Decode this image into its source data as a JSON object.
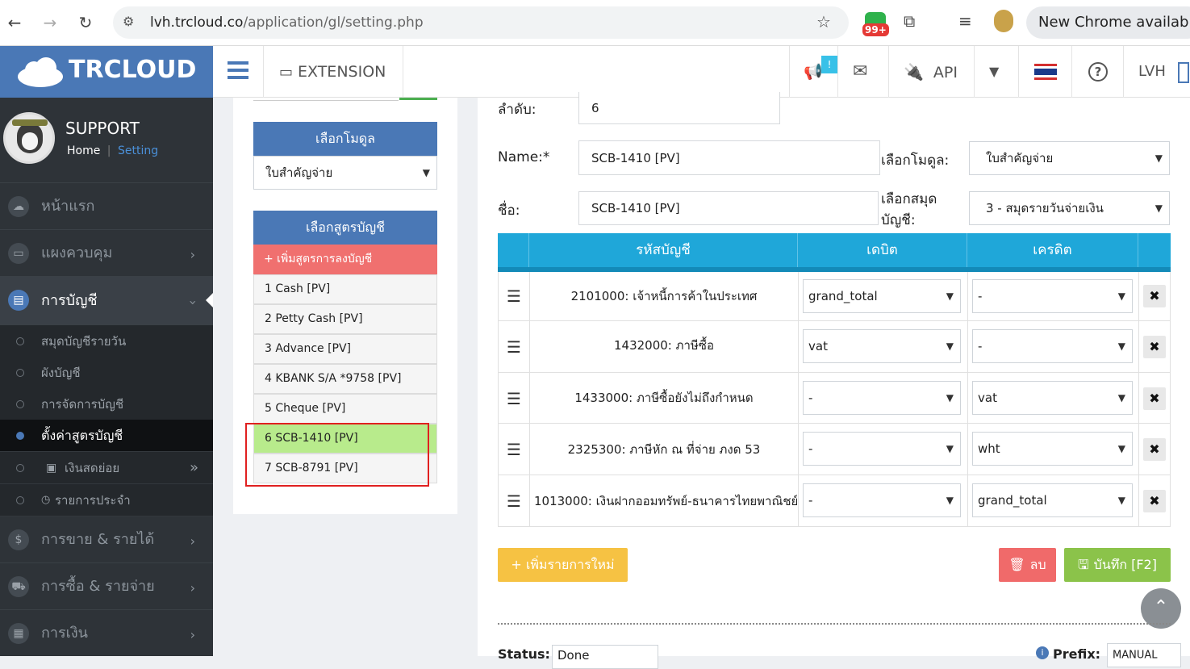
{
  "browser": {
    "url_host": "lvh.trcloud.co",
    "url_path": "/application/gl/setting.php",
    "ext_badge": "99+",
    "update_banner": "New Chrome available"
  },
  "header": {
    "logo": "TRCLOUD",
    "extension_label": "EXTENSION",
    "notif_count": "!",
    "api_label": "API",
    "user_label": "LVH"
  },
  "profile": {
    "name": "SUPPORT",
    "crumb_home": "Home",
    "crumb_sep": "|",
    "crumb_current": "Setting"
  },
  "sidebar": {
    "main": [
      {
        "label": "หน้าแรก",
        "icon": "cloud-icon"
      },
      {
        "label": "แผงควบคุม",
        "icon": "monitor-icon"
      },
      {
        "label": "การบัญชี",
        "icon": "book-icon"
      },
      {
        "label": "การขาย & รายได้",
        "icon": "dollar-icon"
      },
      {
        "label": "การซื้อ & รายจ่าย",
        "icon": "cart-icon"
      },
      {
        "label": "การเงิน",
        "icon": "calendar-icon"
      }
    ],
    "sub": [
      {
        "label": "สมุดบัญชีรายวัน"
      },
      {
        "label": "ผังบัญชี"
      },
      {
        "label": "การจัดการบัญชี"
      },
      {
        "label": "ตั้งค่าสูตรบัญชี"
      },
      {
        "label": "เงินสดย่อย"
      },
      {
        "label": "รายการประจำ"
      }
    ]
  },
  "left_panel": {
    "module_title": "เลือกโมดูล",
    "module_value": "ใบสำคัญจ่าย",
    "formula_title": "เลือกสูตรบัญชี",
    "add_formula": "+ เพิ่มสูตรการลงบัญชี",
    "formulas": [
      {
        "label": "1 Cash [PV]"
      },
      {
        "label": "2 Petty Cash [PV]"
      },
      {
        "label": "3 Advance [PV]"
      },
      {
        "label": "4 KBANK S/A *9758 [PV]"
      },
      {
        "label": "5 Cheque [PV]"
      },
      {
        "label": "6 SCB-1410 [PV]"
      },
      {
        "label": "7 SCB-8791 [PV]"
      }
    ],
    "selected_index": 5
  },
  "form": {
    "order_label": "ลำดับ:",
    "order_value": "6",
    "name_label": "Name:*",
    "name_value": "SCB-1410 [PV]",
    "module_label": "เลือกโมดูล:",
    "module_value": "ใบสำคัญจ่าย",
    "thai_name_label": "ชื่อ:",
    "thai_name_value": "SCB-1410 [PV]",
    "journal_label": "เลือกสมุดบัญชี:",
    "journal_value": "3 - สมุดรายวันจ่ายเงิน",
    "col_account": "รหัสบัญชี",
    "col_debit": "เดบิต",
    "col_credit": "เครดิต",
    "rows": [
      {
        "account": "2101000: เจ้าหนี้การค้าในประเทศ",
        "debit": "grand_total",
        "credit": "-"
      },
      {
        "account": "1432000: ภาษีซื้อ",
        "debit": "vat",
        "credit": "-"
      },
      {
        "account": "1433000: ภาษีซื้อยังไม่ถึงกำหนด",
        "debit": "-",
        "credit": "vat"
      },
      {
        "account": "2325300: ภาษีหัก ณ ที่จ่าย ภงด 53",
        "debit": "-",
        "credit": "wht"
      },
      {
        "account": "1013000: เงินฝากออมทรัพย์-ธนาคารไทยพาณิชย์",
        "debit": "-",
        "credit": "grand_total"
      }
    ],
    "add_row_label": "+ เพิ่มรายการใหม่",
    "delete_label": "ลบ",
    "save_label": "บันทึก [F2]",
    "status_label": "Status:",
    "status_value": "Done",
    "prefix_label": "Prefix:",
    "prefix_value": "MANUAL"
  },
  "colors": {
    "brand": "#4a78b6",
    "grid_header": "#1fa7d9",
    "selected": "#b8eb8c",
    "add_formula": "#f0706f",
    "add_row": "#f6c243",
    "delete": "#f06a6a",
    "save": "#8bc34a"
  }
}
